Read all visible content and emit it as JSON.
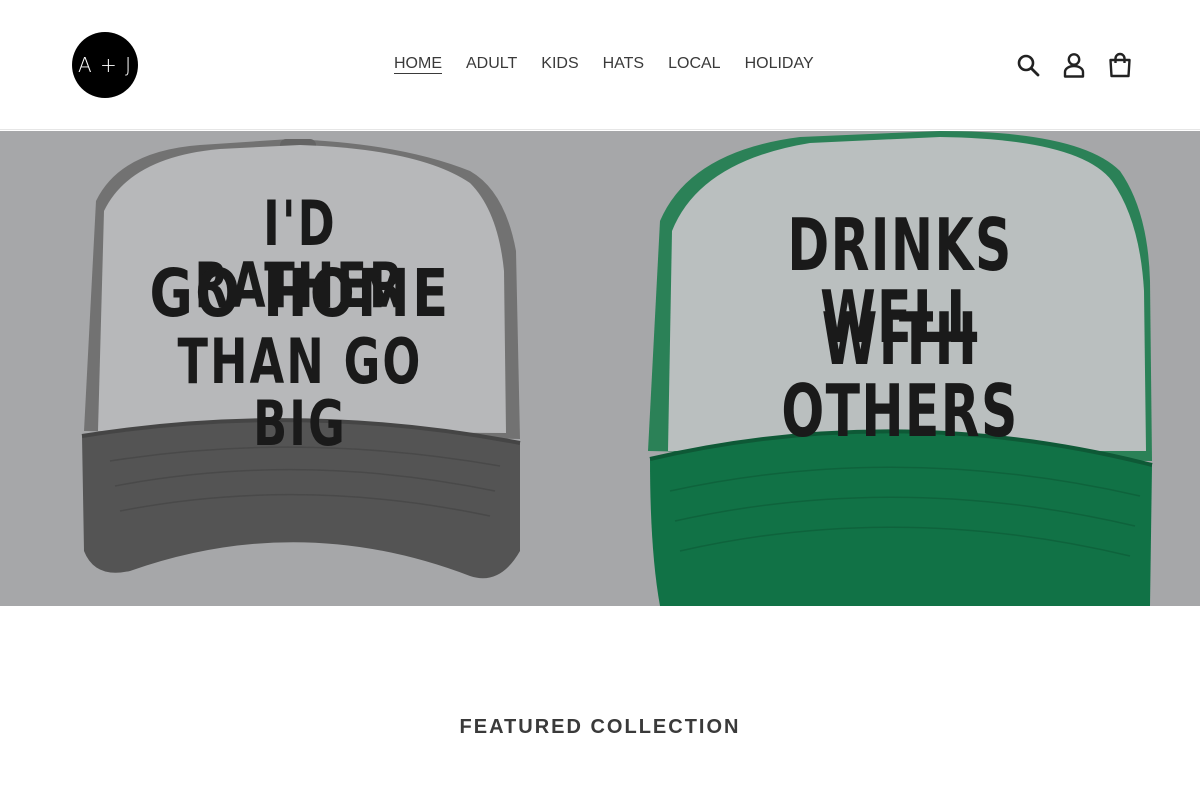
{
  "header": {
    "logo_text": "A + J",
    "nav": [
      {
        "label": "HOME",
        "active": true
      },
      {
        "label": "ADULT"
      },
      {
        "label": "KIDS"
      },
      {
        "label": "HATS"
      },
      {
        "label": "LOCAL"
      },
      {
        "label": "HOLIDAY"
      }
    ],
    "icons": [
      "search-icon",
      "account-icon",
      "cart-icon"
    ]
  },
  "hero": {
    "hat_left": {
      "lines": [
        "I'D RATHER",
        "GO HOME",
        "THAN GO BIG"
      ],
      "front_color": "#c3c4c6",
      "brim_color": "#5a5a5a"
    },
    "hat_right": {
      "lines": [
        "DRINKS WELL",
        "WITH OTHERS"
      ],
      "front_color": "#c6cbcb",
      "brim_color": "#137a4b"
    },
    "background_color": "#b1b2b4"
  },
  "featured": {
    "title": "FEATURED COLLECTION"
  }
}
